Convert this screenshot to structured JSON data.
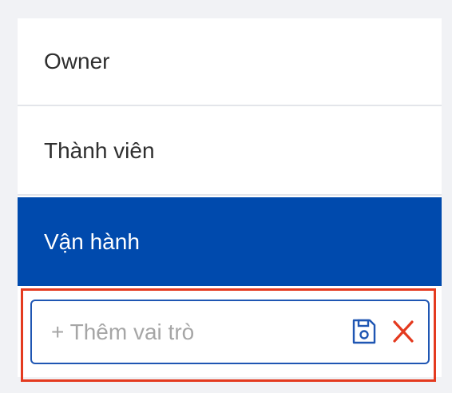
{
  "roles": [
    {
      "label": "Owner",
      "selected": false
    },
    {
      "label": "Thành viên",
      "selected": false
    },
    {
      "label": "Vận hành",
      "selected": true
    }
  ],
  "add_role": {
    "placeholder": "+ Thêm vai trò",
    "value": "",
    "save_icon": "save-icon",
    "cancel_icon": "close-icon"
  },
  "colors": {
    "selected_background": "#004aad",
    "highlight_border": "#e43a1f",
    "save_icon": "#1f56b3",
    "cancel_icon": "#e43a1f"
  }
}
